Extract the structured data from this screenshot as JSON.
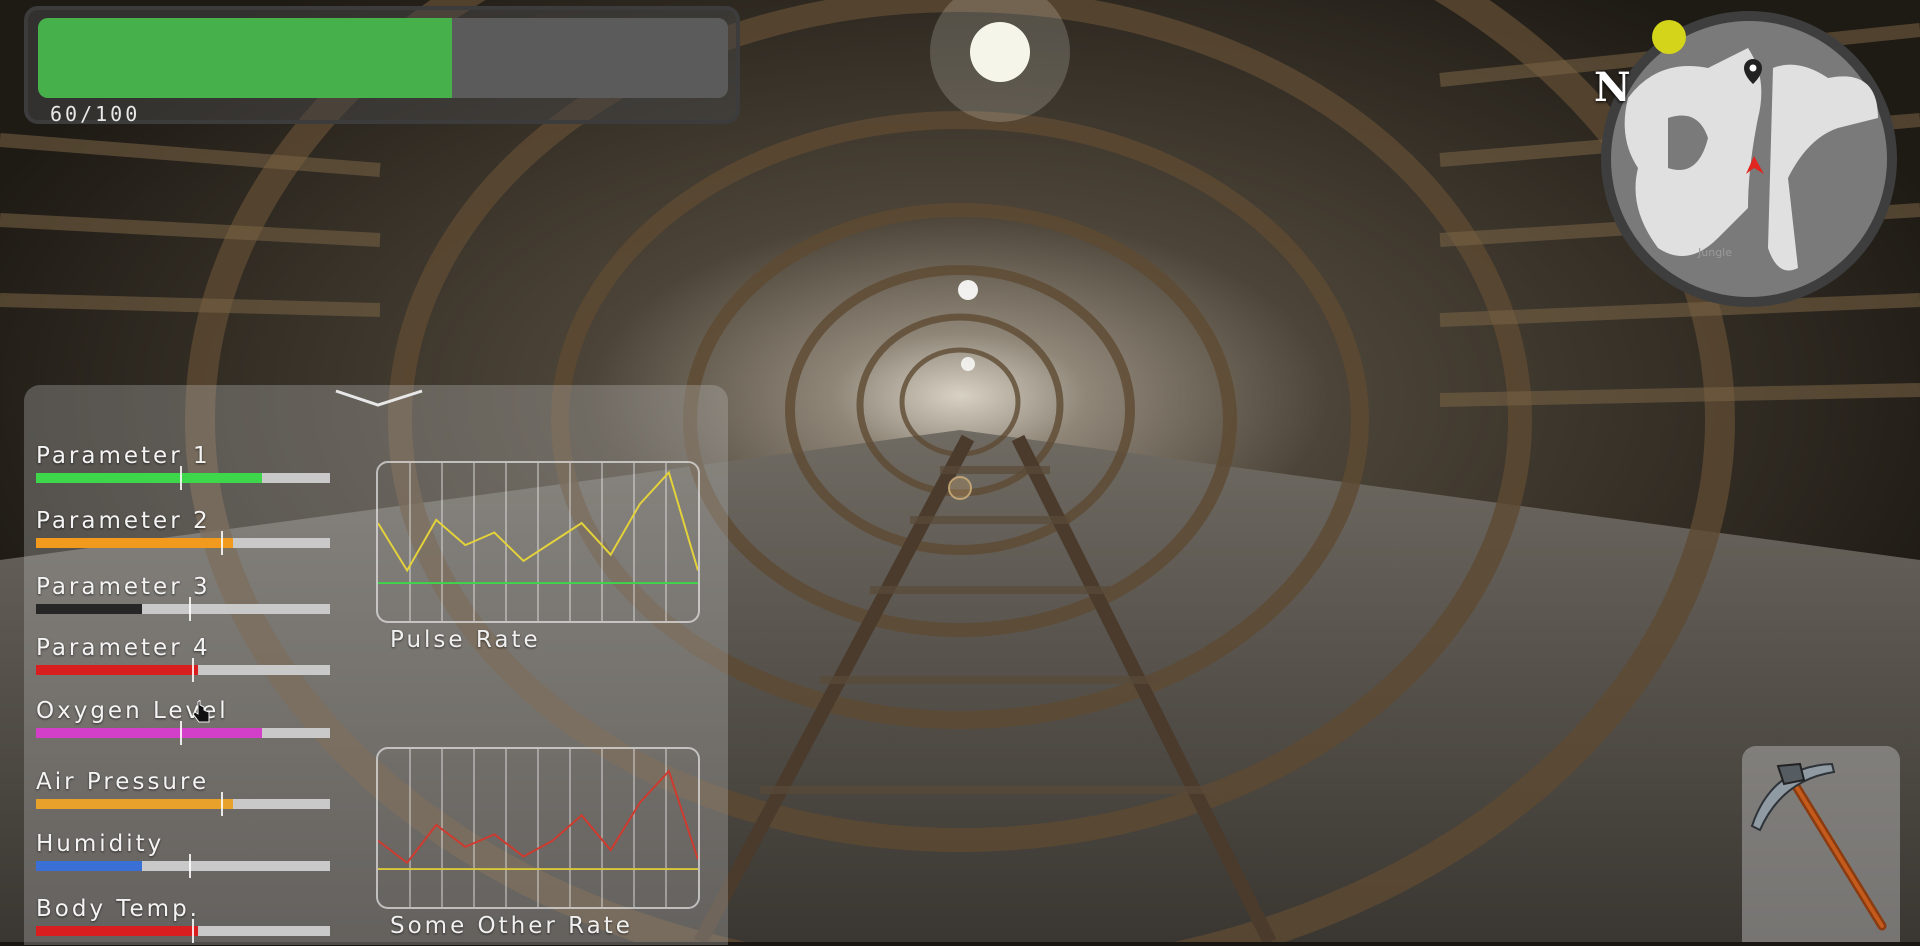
{
  "health": {
    "value": 60,
    "max": 100,
    "label": "60/100",
    "color": "#46b04a"
  },
  "minimap": {
    "compass": "N",
    "player_icon": "red-arrow-icon",
    "waypoint_icon": "map-pin-icon",
    "status_dot_color": "#d4d41a",
    "place_label": "Jungle"
  },
  "parameters": [
    {
      "label": "Parameter 1",
      "value": 0.77,
      "color": "#3ed64a"
    },
    {
      "label": "Parameter 2",
      "value": 0.67,
      "color": "#f29a1e"
    },
    {
      "label": "Parameter 3",
      "value": 0.36,
      "color": "#262626"
    },
    {
      "label": "Parameter 4",
      "value": 0.55,
      "color": "#d81e1e"
    },
    {
      "label": "Oxygen Level",
      "value": 0.77,
      "color": "#d33fc9"
    },
    {
      "label": "Air Pressure",
      "value": 0.67,
      "color": "#e8a12a"
    },
    {
      "label": "Humidity",
      "value": 0.36,
      "color": "#3a6fd6"
    },
    {
      "label": "Body Temp.",
      "value": 0.55,
      "color": "#d81e1e"
    }
  ],
  "graphs": [
    {
      "label": "Pulse Rate",
      "color": "#e4d23a",
      "baseline_color": "#3ed64a",
      "values": [
        0.62,
        0.32,
        0.64,
        0.48,
        0.56,
        0.38,
        0.5,
        0.62,
        0.42,
        0.74,
        0.94,
        0.32
      ]
    },
    {
      "label": "Some Other Rate",
      "color": "#cf3a2e",
      "baseline_color": "#d8c83a",
      "values": [
        0.42,
        0.28,
        0.52,
        0.38,
        0.46,
        0.32,
        0.42,
        0.58,
        0.36,
        0.66,
        0.86,
        0.3
      ]
    }
  ],
  "tool": {
    "icon": "pickaxe-icon"
  }
}
